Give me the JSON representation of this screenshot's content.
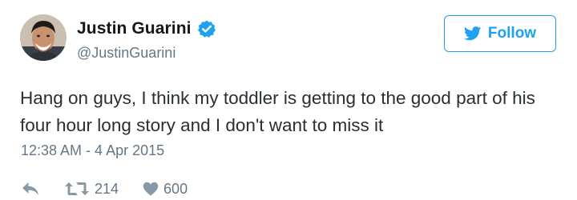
{
  "user": {
    "display_name": "Justin Guarini",
    "handle": "@JustinGuarini",
    "verified": true,
    "avatar_icon": "profile-photo"
  },
  "follow_button": {
    "label": "Follow",
    "icon": "twitter-bird-icon"
  },
  "tweet": {
    "text": "Hang on guys, I think my toddler is getting to the good part of his four hour long story and I don't want to miss it",
    "timestamp": "12:38 AM - 4 Apr 2015"
  },
  "actions": {
    "reply_icon": "reply-icon",
    "retweet_icon": "retweet-icon",
    "retweet_count": "214",
    "like_icon": "heart-icon",
    "like_count": "600"
  },
  "colors": {
    "accent": "#1da1f2",
    "text": "#292f33",
    "muted": "#657786",
    "name": "#14171a"
  }
}
